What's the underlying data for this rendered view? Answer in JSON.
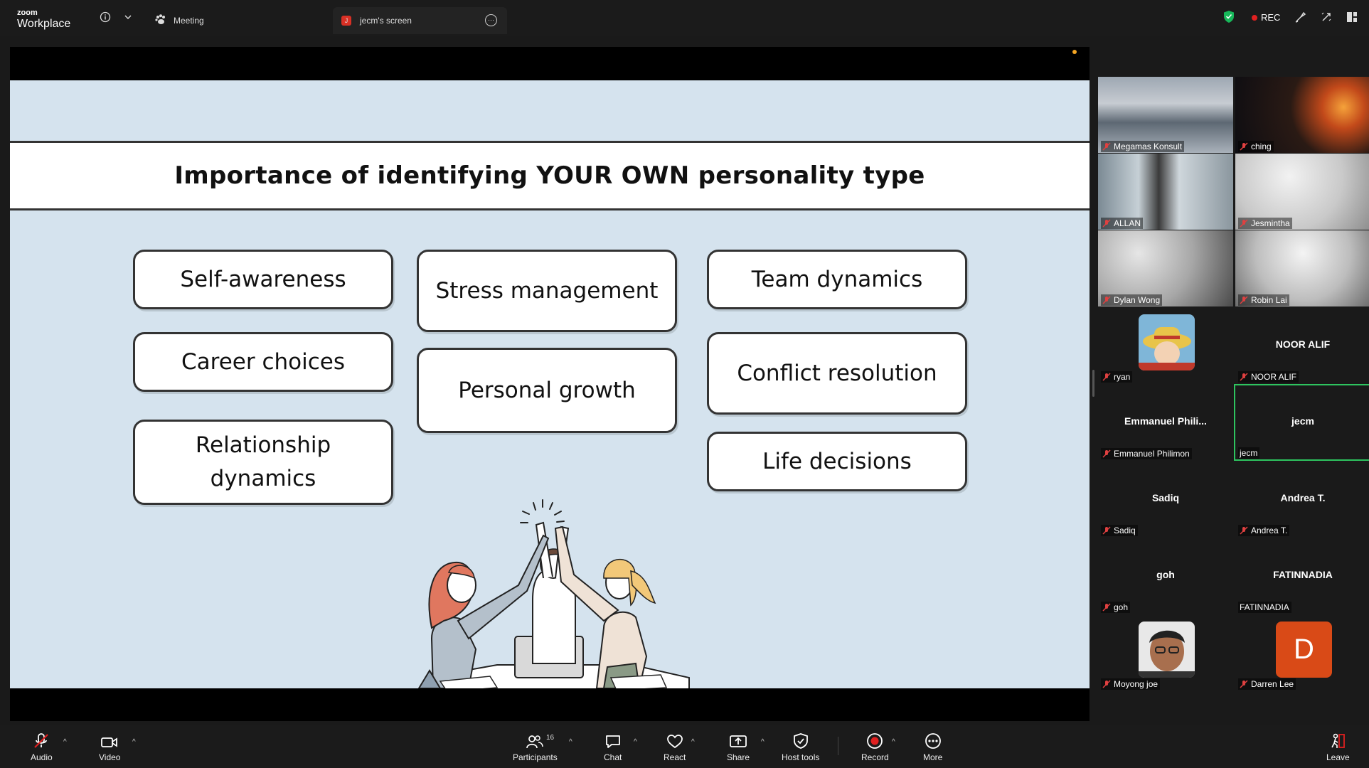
{
  "app": {
    "brand_small": "zoom",
    "brand_name": "Workplace"
  },
  "tabs": {
    "meeting": "Meeting",
    "screen": "jecm's screen",
    "screen_badge": "J"
  },
  "status": {
    "rec": "REC",
    "rec_color": "#e02020",
    "shield_color": "#17b85a"
  },
  "slide": {
    "title": "Importance of identifying YOUR OWN personality type",
    "col1": [
      "Self-awareness",
      "Career choices",
      "Relationship dynamics"
    ],
    "col2": [
      "Stress management",
      "Personal growth"
    ],
    "col3": [
      "Team dynamics",
      "Conflict resolution",
      "Life decisions"
    ],
    "background": "#d5e3ee"
  },
  "participants": [
    {
      "name": "Megamas Konsult",
      "kind": "video"
    },
    {
      "name": "ching",
      "kind": "video"
    },
    {
      "name": "ALLAN",
      "kind": "video"
    },
    {
      "name": "Jesmintha",
      "kind": "video"
    },
    {
      "name": "Dylan Wong",
      "kind": "video"
    },
    {
      "name": "Robin Lai",
      "kind": "video"
    },
    {
      "name": "ryan",
      "kind": "avatar"
    },
    {
      "name": "NOOR ALIF",
      "display": "NOOR ALIF",
      "kind": "name"
    },
    {
      "name": "Emmanuel Philimon",
      "display": "Emmanuel  Phili...",
      "kind": "name"
    },
    {
      "name": "jecm",
      "display": "jecm",
      "kind": "name",
      "active": true
    },
    {
      "name": "Sadiq",
      "display": "Sadiq",
      "kind": "name"
    },
    {
      "name": "Andrea T.",
      "display": "Andrea T.",
      "kind": "name"
    },
    {
      "name": "goh",
      "display": "goh",
      "kind": "name"
    },
    {
      "name": "FATINNADIA",
      "display": "FATINNADIA",
      "kind": "name",
      "unmuted": true
    },
    {
      "name": "Moyong joe",
      "kind": "avatar"
    },
    {
      "name": "Darren Lee",
      "kind": "letter",
      "letter": "D"
    }
  ],
  "toolbar": {
    "audio": "Audio",
    "video": "Video",
    "participants": "Participants",
    "participants_count": "16",
    "chat": "Chat",
    "react": "React",
    "share": "Share",
    "host_tools": "Host tools",
    "record": "Record",
    "more": "More",
    "leave": "Leave"
  }
}
